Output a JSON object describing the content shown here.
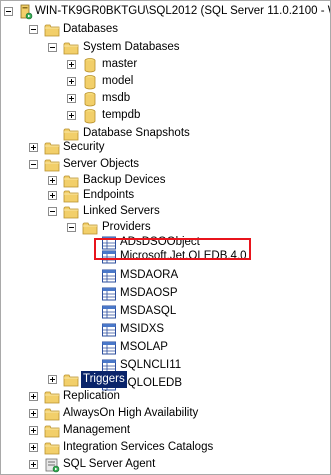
{
  "tree": {
    "root": "WIN-TK9GR0BKTGU\\SQL2012 (SQL Server 11.0.2100 - WIN-TK9",
    "databases": "Databases",
    "system_databases": "System Databases",
    "master": "master",
    "model": "model",
    "msdb": "msdb",
    "tempdb": "tempdb",
    "database_snapshots": "Database Snapshots",
    "security": "Security",
    "server_objects": "Server Objects",
    "backup_devices": "Backup Devices",
    "endpoints": "Endpoints",
    "linked_servers": "Linked Servers",
    "providers": "Providers",
    "provider_items": [
      "ADsDSOObject",
      "Microsoft.Jet.OLEDB.4.0",
      "MSDAORA",
      "MSDAOSP",
      "MSDASQL",
      "MSIDXS",
      "MSOLAP",
      "SQLNCLI11",
      "SQLOLEDB"
    ],
    "triggers": "Triggers",
    "replication": "Replication",
    "alwayson": "AlwaysOn High Availability",
    "management": "Management",
    "integration_services": "Integration Services Catalogs",
    "sql_server_agent": "SQL Server Agent"
  },
  "colors": {
    "selection_bg": "#0a246a",
    "highlight_border": "#e8141c",
    "folder": "#f2cf6a"
  }
}
